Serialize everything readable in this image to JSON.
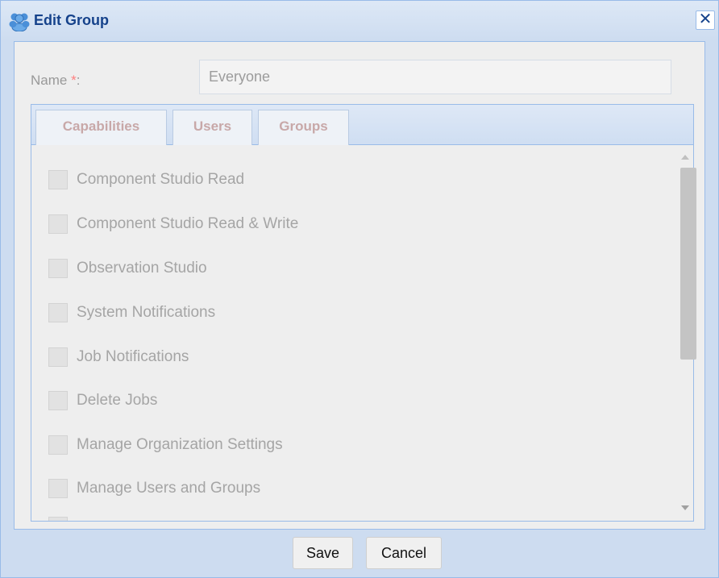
{
  "dialog": {
    "title": "Edit Group",
    "close_label": "✕",
    "icon": "users-group-icon"
  },
  "form": {
    "name_label": "Name",
    "required_marker": "*",
    "name_colon": ":",
    "name_value": "Everyone"
  },
  "tabs": [
    {
      "label": "Capabilities"
    },
    {
      "label": "Users"
    },
    {
      "label": "Groups"
    }
  ],
  "capabilities": [
    {
      "label": "Component Studio Read",
      "checked": false
    },
    {
      "label": "Component Studio Read & Write",
      "checked": false
    },
    {
      "label": "Observation Studio",
      "checked": false
    },
    {
      "label": "System Notifications",
      "checked": false
    },
    {
      "label": "Job Notifications",
      "checked": false
    },
    {
      "label": "Delete Jobs",
      "checked": false
    },
    {
      "label": "Manage Organization Settings",
      "checked": false
    },
    {
      "label": "Manage Users and Groups",
      "checked": false
    }
  ],
  "footer": {
    "save_label": "Save",
    "cancel_label": "Cancel"
  },
  "colors": {
    "header_text": "#15428b",
    "border": "#99bbe8",
    "panel": "#eeeeee",
    "frame": "#cddcf0"
  }
}
